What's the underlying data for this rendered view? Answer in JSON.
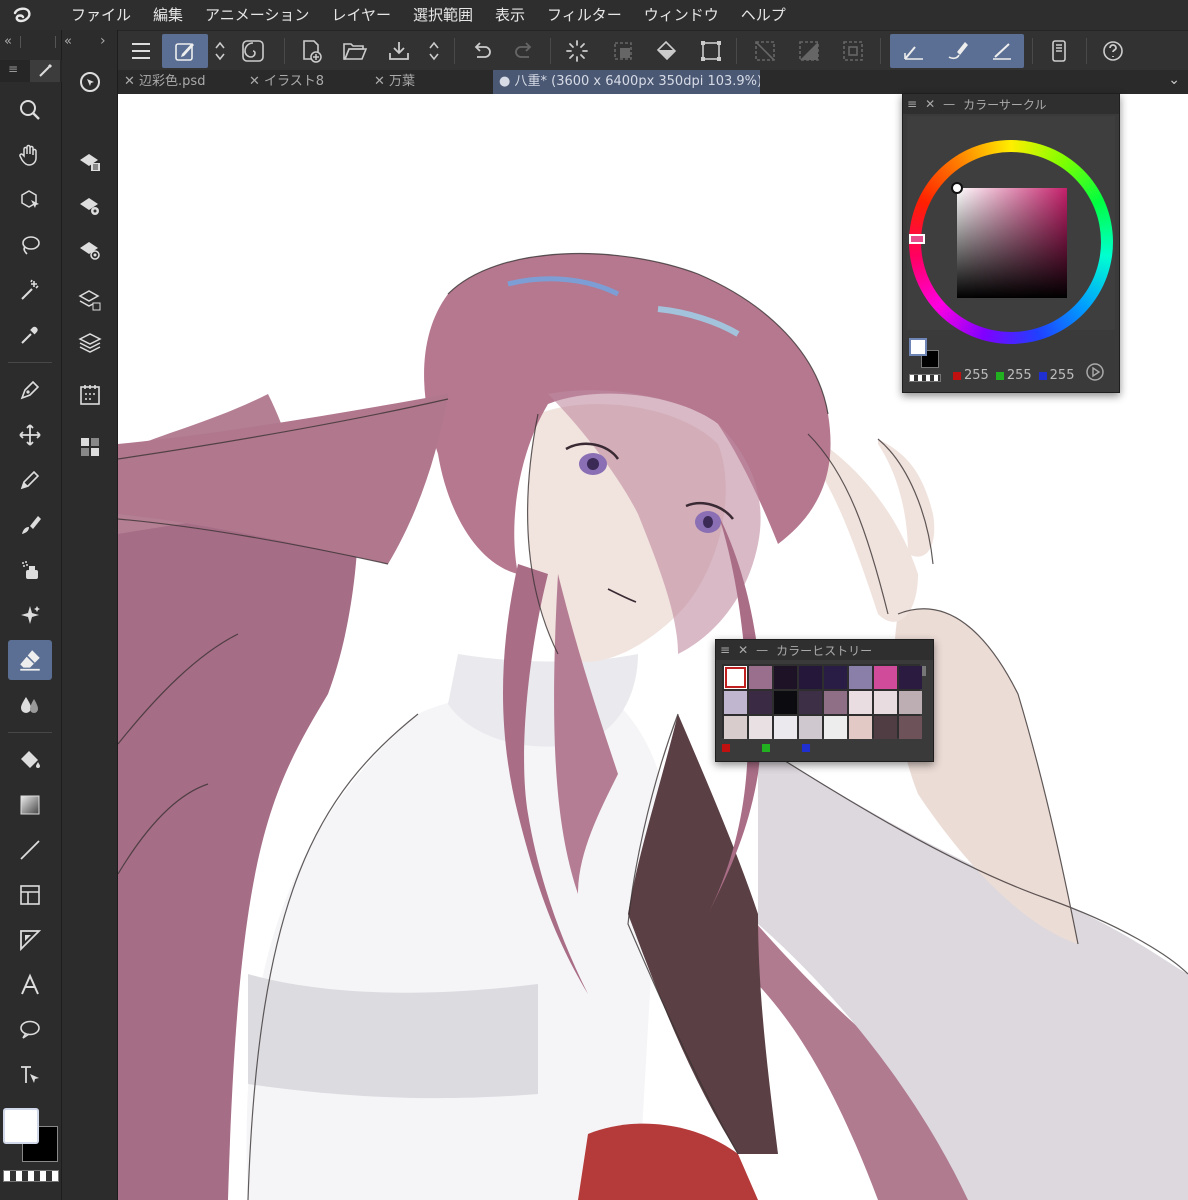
{
  "menubar": {
    "items": [
      "ファイル",
      "編集",
      "アニメーション",
      "レイヤー",
      "選択範囲",
      "表示",
      "フィルター",
      "ウィンドウ",
      "ヘルプ"
    ]
  },
  "tabs": [
    {
      "label": "辺彩色.psd",
      "active": false
    },
    {
      "label": "イラスト8",
      "active": false
    },
    {
      "label": "万葉",
      "active": false
    },
    {
      "label": "八重* (3600 x 6400px 350dpi 103.9%)",
      "active": true
    }
  ],
  "color_circle": {
    "title": "カラーサークル",
    "red_value": "255",
    "green_value": "255",
    "blue_value": "255",
    "hue_color": "#c4206a"
  },
  "color_history": {
    "title": "カラーヒストリー",
    "swatches": [
      "#ffffff",
      "#9a6f8d",
      "#1d1226",
      "#24173a",
      "#2a1d45",
      "#8a7fa8",
      "#d04c9a",
      "#2b1b40",
      "#c1b6cf",
      "#3b2a44",
      "#0b0b10",
      "#3d2f45",
      "#8f6f86",
      "#eadde2",
      "#e8dce0",
      "#bcaeb2",
      "#d9cccd",
      "#e9e0e3",
      "#ebe9ed",
      "#cfc9cf",
      "#ededee",
      "#e3c9c5",
      "#4f3d43",
      "#6e5259"
    ]
  },
  "colors": {
    "accent": "#5a6f93",
    "main_color": "#ffffff",
    "sub_color": "#000000"
  }
}
